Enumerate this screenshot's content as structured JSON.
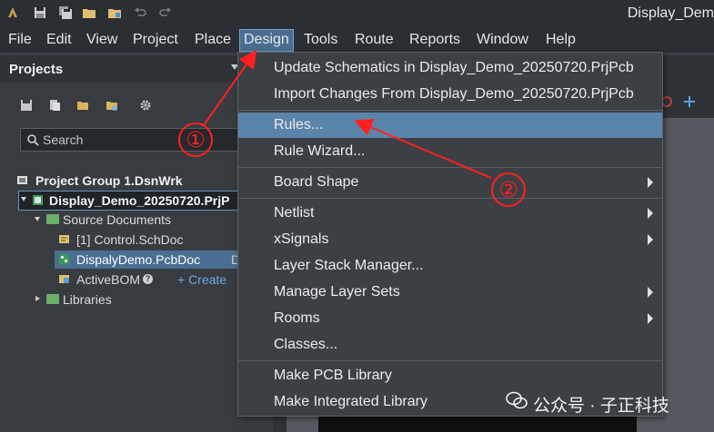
{
  "title_bar": {
    "app_title": "Display_Dem",
    "icons": [
      "app-logo-icon",
      "save-icon",
      "save-all-icon",
      "open-folder-icon",
      "open-project-icon",
      "undo-icon",
      "redo-icon"
    ]
  },
  "menu_bar": {
    "items": [
      "File",
      "Edit",
      "View",
      "Project",
      "Place",
      "Design",
      "Tools",
      "Route",
      "Reports",
      "Window",
      "Help"
    ],
    "active": "Design"
  },
  "projects_panel": {
    "title": "Projects",
    "search_placeholder": "Search",
    "tree": {
      "group": "Project Group 1.DsnWrk",
      "project": "Display_Demo_20250720.PrjP",
      "source_documents": "Source Documents",
      "schdoc": "[1] Control.SchDoc",
      "pcbdoc": "DispalyDemo.PcbDoc",
      "pcbdoc_flag": "D",
      "activebom": "ActiveBOM",
      "create": "+ Create",
      "libraries": "Libraries"
    }
  },
  "design_menu": {
    "items": [
      {
        "label": "Update Schematics in Display_Demo_20250720.PrjPcb",
        "submenu": false
      },
      {
        "label": "Import Changes From Display_Demo_20250720.PrjPcb",
        "submenu": false
      },
      {
        "label": "Rules...",
        "submenu": false,
        "highlighted": true
      },
      {
        "label": "Rule Wizard...",
        "submenu": false
      },
      {
        "label": "Board Shape",
        "submenu": true
      },
      {
        "label": "Netlist",
        "submenu": true
      },
      {
        "label": "xSignals",
        "submenu": true
      },
      {
        "label": "Layer Stack Manager...",
        "submenu": false
      },
      {
        "label": "Manage Layer Sets",
        "submenu": true
      },
      {
        "label": "Rooms",
        "submenu": true
      },
      {
        "label": "Classes...",
        "submenu": false
      },
      {
        "label": "Make PCB Library",
        "submenu": false
      },
      {
        "label": "Make Integrated Library",
        "submenu": false
      }
    ]
  },
  "annotations": {
    "step1": "①",
    "step2": "②",
    "arrow_color": "#ff2020"
  },
  "watermark": "公众号 · 子正科技",
  "colors": {
    "highlight": "#5b84ab",
    "menu_bg": "#3c3f44",
    "selected_row": "#4a6e92"
  }
}
